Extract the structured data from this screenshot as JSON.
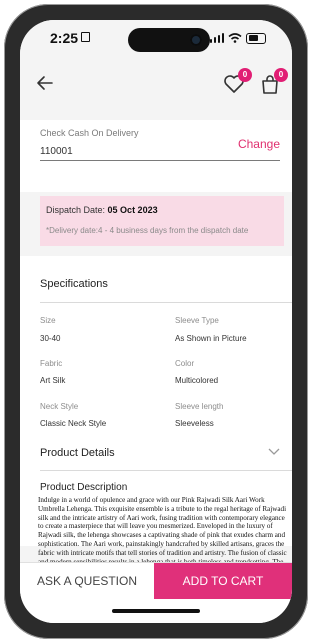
{
  "status_bar": {
    "time": "2:25"
  },
  "header": {
    "wishlist_count": "0",
    "bag_count": "0"
  },
  "cod": {
    "label": "Check Cash On Delivery",
    "pincode": "110001",
    "change_label": "Change"
  },
  "dispatch": {
    "prefix": "Dispatch Date:",
    "date": "05 Oct 2023",
    "note": "*Delivery date:4 - 4 business days from the dispatch date"
  },
  "specifications": {
    "title": "Specifications",
    "items": [
      {
        "label": "Size",
        "value": "30-40"
      },
      {
        "label": "Sleeve Type",
        "value": "As Shown in Picture"
      },
      {
        "label": "Fabric",
        "value": "Art Silk"
      },
      {
        "label": "Color",
        "value": "Multicolored"
      },
      {
        "label": "Neck Style",
        "value": "Classic Neck Style"
      },
      {
        "label": "Sleeve length",
        "value": "Sleeveless"
      }
    ]
  },
  "product_details": {
    "label": "Product Details"
  },
  "description": {
    "title": "Product Description",
    "text": "Indulge in a world of opulence and grace with our Pink Rajwadi Silk Aari Work Umbrella Lehenga. This exquisite ensemble is a tribute to the regal heritage of Rajwadi silk and the intricate artistry of Aari work, fusing tradition with contemporary elegance to create a masterpiece that will leave you mesmerized. Enveloped in the luxury of Rajwadi silk, the lehenga showcases a captivating shade of pink that exudes charm and sophistication. The Aari work, painstakingly handcrafted by skilled artisans, graces the fabric with intricate motifs that tell stories of tradition and artistry. The fusion of classic and modern sensibilities results in a lehenga that is both timeless and trendsetting. The Aari work, a"
  },
  "actions": {
    "ask": "ASK A QUESTION",
    "cart": "ADD TO CART"
  },
  "colors": {
    "accent": "#e0307a",
    "dispatch_bg": "#f9dbe6"
  }
}
